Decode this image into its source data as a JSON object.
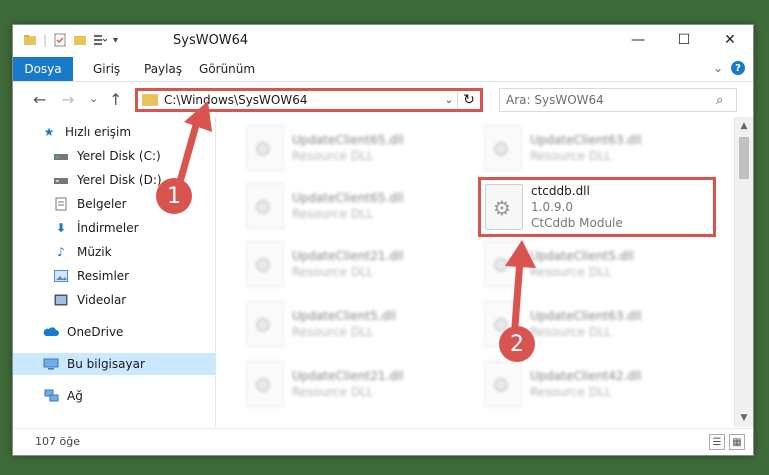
{
  "window": {
    "title": "SysWOW64",
    "minimize": "—",
    "maximize": "☐",
    "close": "✕"
  },
  "ribbon": {
    "file_tab": "Dosya",
    "tabs": [
      "Giriş",
      "Paylaş",
      "Görünüm"
    ],
    "help": "?"
  },
  "nav": {
    "back": "←",
    "forward": "→",
    "recent": "⌄",
    "up": "↑",
    "path": "C:\\Windows\\SysWOW64",
    "search_placeholder": "Ara: SysWOW64"
  },
  "sidebar": {
    "items": [
      {
        "label": "Hızlı erişim",
        "icon": "star-icon"
      },
      {
        "label": "Yerel Disk (C:)",
        "icon": "drive-icon"
      },
      {
        "label": "Yerel Disk (D:)",
        "icon": "drive-icon"
      },
      {
        "label": "Belgeler",
        "icon": "documents-icon"
      },
      {
        "label": "İndirmeler",
        "icon": "downloads-icon"
      },
      {
        "label": "Müzik",
        "icon": "music-icon"
      },
      {
        "label": "Resimler",
        "icon": "pictures-icon"
      },
      {
        "label": "Videolar",
        "icon": "videos-icon"
      },
      {
        "label": "OneDrive",
        "icon": "cloud-icon"
      },
      {
        "label": "Bu bilgisayar",
        "icon": "computer-icon"
      },
      {
        "label": "Ağ",
        "icon": "network-icon"
      }
    ]
  },
  "files": [
    {
      "name": "UpdateClient65.dll",
      "sub": "Resource DLL"
    },
    {
      "name": "UpdateClient63.dll",
      "sub": "Resource DLL"
    },
    {
      "name": "UpdateClient65.dll",
      "sub": "Resource DLL"
    },
    {
      "name": "UpdateClient21.dll",
      "sub": "Resource DLL"
    },
    {
      "name": "UpdateClient5.dll",
      "sub": "Resource DLL"
    },
    {
      "name": "UpdateClient5.dll",
      "sub": "Resource DLL"
    },
    {
      "name": "UpdateClient63.dll",
      "sub": "Resource DLL"
    },
    {
      "name": "UpdateClient21.dll",
      "sub": "Resource DLL"
    },
    {
      "name": "UpdateClient42.dll",
      "sub": "Resource DLL"
    }
  ],
  "highlighted_file": {
    "name": "ctcddb.dll",
    "version": "1.0.9.0",
    "description": "CtCddb Module"
  },
  "status": {
    "count": "107 öğe"
  },
  "annotations": {
    "step1": "1",
    "step2": "2",
    "accent_color": "#d9534f"
  }
}
